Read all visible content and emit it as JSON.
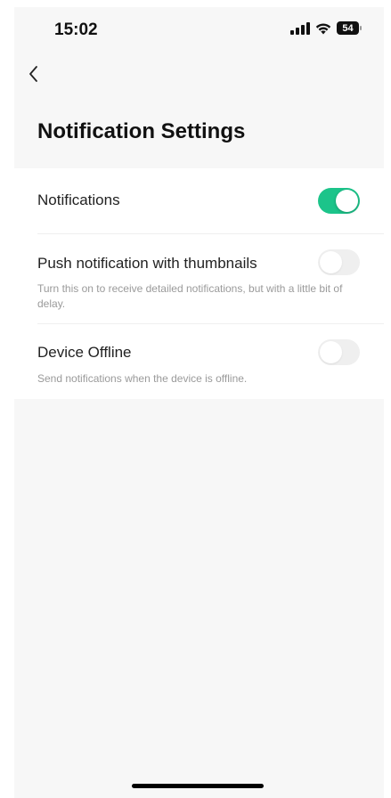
{
  "status_bar": {
    "time": "15:02",
    "battery": "54"
  },
  "header": {
    "back_icon": "chevron-left-icon",
    "title": "Notification Settings"
  },
  "settings": [
    {
      "label": "Notifications",
      "description": "",
      "enabled": true
    },
    {
      "label": "Push notification with thumbnails",
      "description": "Turn this on to receive detailed notifications, but with a little bit of delay.",
      "enabled": false
    },
    {
      "label": "Device Offline",
      "description": "Send notifications when the device is offline.",
      "enabled": false
    }
  ],
  "colors": {
    "toggle_on": "#1cc48a",
    "toggle_off": "#efefef",
    "background": "#f7f7f7"
  }
}
